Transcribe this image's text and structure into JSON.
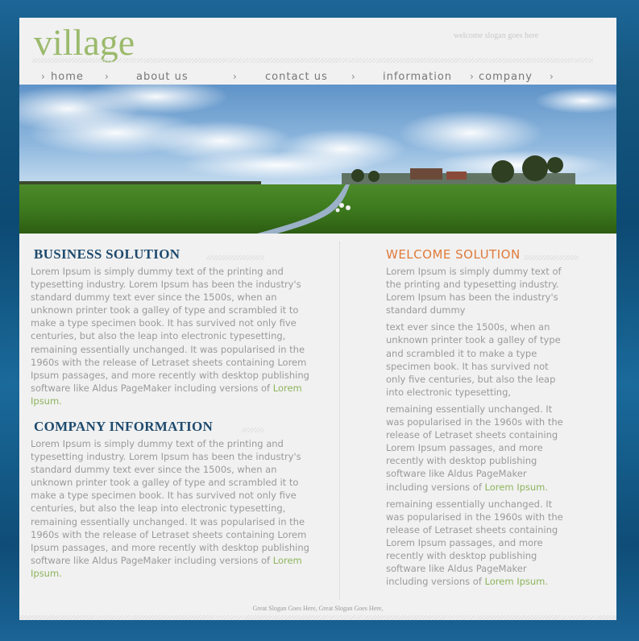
{
  "header": {
    "logo": "village",
    "slogan": "welcome slogan goes here"
  },
  "nav": {
    "items": [
      {
        "label": "home"
      },
      {
        "label": "about us"
      },
      {
        "label": "contact us"
      },
      {
        "label": "information"
      },
      {
        "label": "company"
      }
    ],
    "separator": "›"
  },
  "banner": {
    "description_icon": "landscape-photo"
  },
  "left": {
    "section1": {
      "title": "BUSINESS SOLUTION",
      "lines": [
        "Lorem Ipsum is simply dummy text of the printing and",
        "typesetting industry. Lorem Ipsum has been the industry's",
        "standard dummy text ever since the 1500s, when an",
        "unknown printer took a galley of type and scrambled it to",
        "make a type specimen book. It has survived not only five",
        "centuries, but also the leap into electronic typesetting,",
        "remaining essentially unchanged. It was popularised in the",
        "1960s with the release of Letraset sheets containing Lorem",
        "Ipsum passages, and more recently with desktop publishing",
        "software like Aldus PageMaker including versions of "
      ],
      "link": "Lorem",
      "link_tail": "Ipsum."
    },
    "section2": {
      "title": "COMPANY INFORMATION",
      "lines": [
        "Lorem Ipsum is simply dummy text of the printing and",
        "typesetting industry. Lorem Ipsum has been the industry's",
        "standard dummy text ever since the 1500s, when an",
        "unknown printer took a galley of type and scrambled it to",
        "make a type specimen book. It has survived not only five",
        "centuries, but also the leap into electronic typesetting,",
        "remaining essentially unchanged. It was popularised in the",
        "1960s with the release of Letraset sheets containing Lorem",
        "Ipsum passages, and more recently with desktop publishing",
        "software like Aldus PageMaker including versions of "
      ],
      "link": "Lorem",
      "link_tail": "Ipsum."
    }
  },
  "right": {
    "title": "WELCOME SOLUTION",
    "para1": [
      "Lorem Ipsum is simply dummy text of",
      "the printing and typesetting industry.",
      "Lorem Ipsum has been the industry's",
      "standard dummy"
    ],
    "para2": [
      "text ever since the 1500s, when an",
      "unknown printer took a galley of type",
      "and scrambled it to make a type",
      "specimen book. It has survived not",
      "only five centuries, but also the leap",
      "into electronic typesetting,"
    ],
    "para3": [
      "remaining essentially unchanged. It",
      "was popularised in the 1960s with the",
      "release of Letraset sheets containing",
      "Lorem Ipsum passages, and more",
      "recently with desktop publishing",
      "software like Aldus PageMaker",
      "including versions of "
    ],
    "para3_link": "Lorem Ipsum.",
    "para4": [
      "remaining essentially unchanged. It",
      "was popularised in the 1960s with the",
      "release of Letraset sheets containing",
      "Lorem Ipsum passages, and more",
      "recently with desktop publishing",
      "software like Aldus PageMaker",
      "including versions of "
    ],
    "para4_link": "Lorem Ipsum."
  },
  "footer": {
    "slogan": "Great Slogan Goes Here, Great Slogan Goes Here,"
  },
  "colors": {
    "logo": "#9bba6c",
    "heading": "#1e4a6e",
    "heading_orange": "#e07a3a",
    "link": "#8db45c",
    "body_text": "#9a9a9a"
  }
}
